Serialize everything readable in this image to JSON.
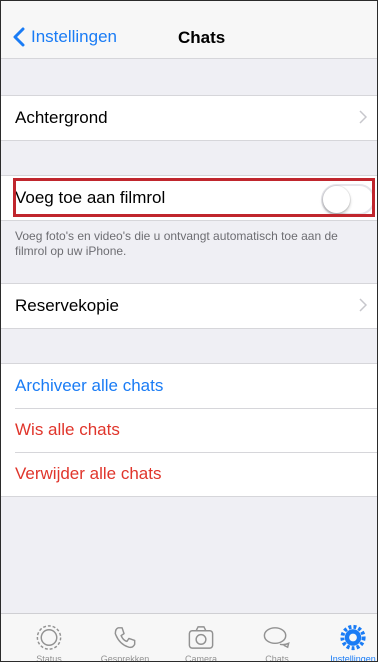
{
  "nav": {
    "back_label": "Instellingen",
    "title": "Chats"
  },
  "rows": {
    "background": "Achtergrond",
    "save_to_camera_roll": "Voeg toe aan filmrol",
    "save_toggle_on": false,
    "save_footnote": "Voeg foto's en video's die u ontvangt automatisch toe aan de filmrol op uw iPhone.",
    "backup": "Reservekopie",
    "archive_all": "Archiveer alle chats",
    "clear_all": "Wis alle chats",
    "delete_all": "Verwijder alle chats"
  },
  "tabs": [
    {
      "label": "Status",
      "icon": "status-icon",
      "active": false
    },
    {
      "label": "Gesprekken",
      "icon": "phone-icon",
      "active": false
    },
    {
      "label": "Camera",
      "icon": "camera-icon",
      "active": false
    },
    {
      "label": "Chats",
      "icon": "chat-bubbles-icon",
      "active": false
    },
    {
      "label": "Instellingen",
      "icon": "settings-gear-icon",
      "active": true
    }
  ],
  "colors": {
    "accent": "#1a7cf5",
    "destructive": "#e0352b",
    "highlight": "#c0262d"
  }
}
